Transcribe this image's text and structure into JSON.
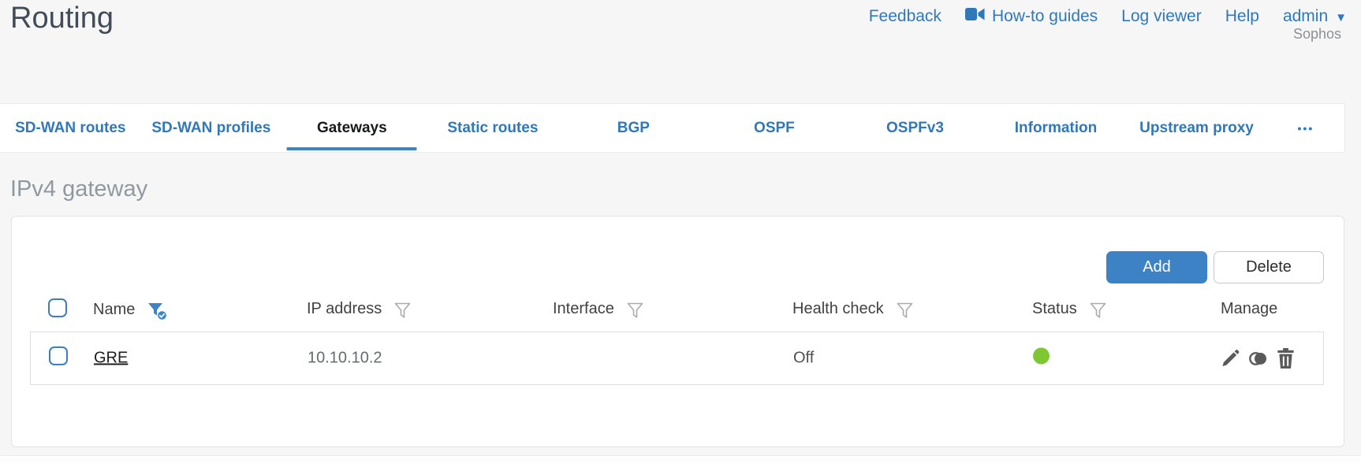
{
  "header": {
    "title": "Routing",
    "nav": {
      "feedback": "Feedback",
      "howto_guides": "How-to guides",
      "log_viewer": "Log viewer",
      "help": "Help",
      "user": "admin",
      "brand": "Sophos"
    }
  },
  "tabs": [
    {
      "label": "SD-WAN routes",
      "active": false
    },
    {
      "label": "SD-WAN profiles",
      "active": false
    },
    {
      "label": "Gateways",
      "active": true
    },
    {
      "label": "Static routes",
      "active": false
    },
    {
      "label": "BGP",
      "active": false
    },
    {
      "label": "OSPF",
      "active": false
    },
    {
      "label": "OSPFv3",
      "active": false
    },
    {
      "label": "Information",
      "active": false
    },
    {
      "label": "Upstream proxy",
      "active": false
    },
    {
      "label": "•••",
      "active": false
    }
  ],
  "section": {
    "title": "IPv4 gateway"
  },
  "toolbar": {
    "add_label": "Add",
    "delete_label": "Delete"
  },
  "table": {
    "columns": [
      {
        "label": "Name",
        "filter": "active"
      },
      {
        "label": "IP address",
        "filter": "inactive"
      },
      {
        "label": "Interface",
        "filter": "inactive"
      },
      {
        "label": "Health check",
        "filter": "inactive"
      },
      {
        "label": "Status",
        "filter": "inactive"
      },
      {
        "label": "Manage",
        "filter": "none"
      }
    ],
    "rows": [
      {
        "name": "GRE",
        "ip_address": "10.10.10.2",
        "interface": "",
        "health_check": "Off",
        "status": "green",
        "manage": [
          "edit",
          "clone",
          "delete"
        ]
      }
    ]
  },
  "colors": {
    "link_blue": "#2f78ba",
    "add_button_blue": "#3d82c4",
    "status_green": "#7dc832",
    "active_tab_underline": "#3c85c8"
  }
}
